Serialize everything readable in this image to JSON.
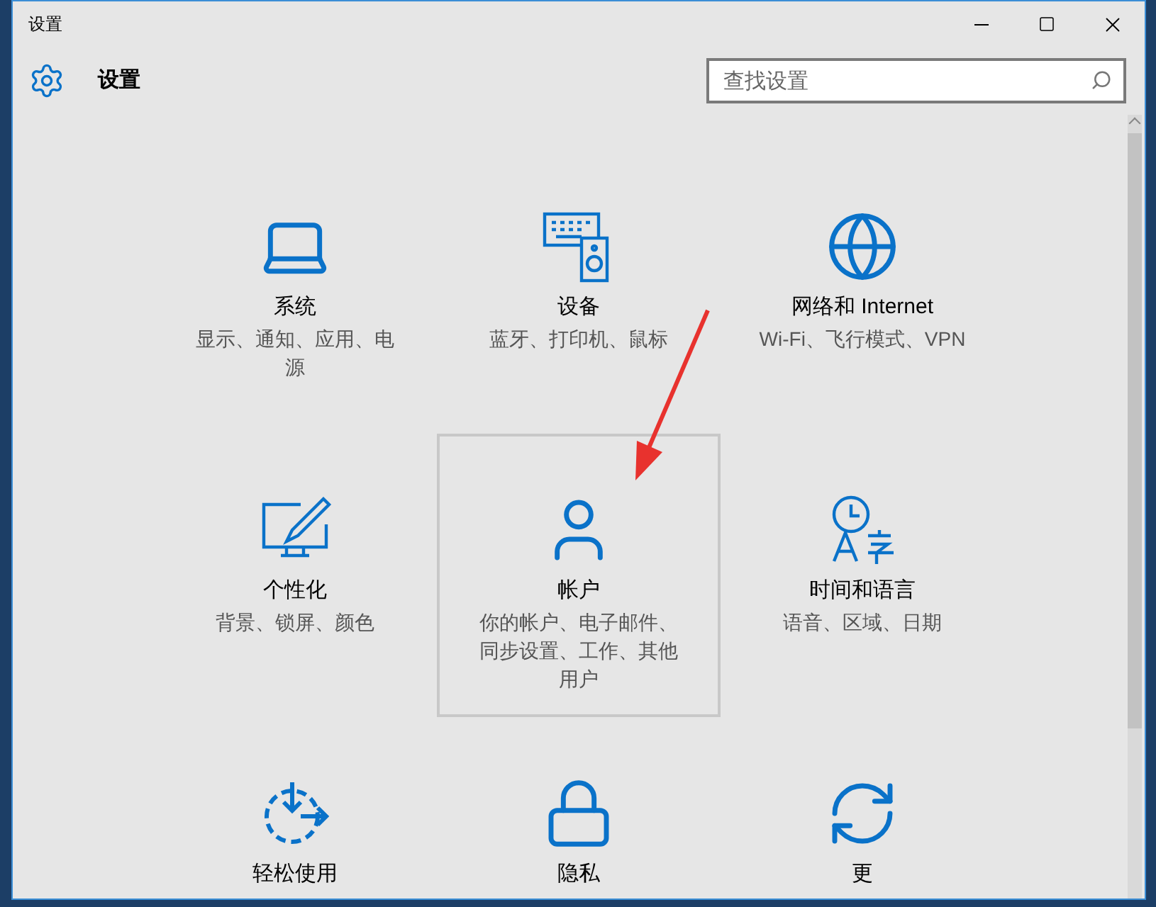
{
  "window": {
    "title": "设置"
  },
  "header": {
    "title": "设置"
  },
  "search": {
    "placeholder": "查找设置"
  },
  "tiles": [
    {
      "kind": "laptop",
      "title": "系统",
      "description": "显示、通知、应用、电源",
      "selected": false
    },
    {
      "kind": "keyboard",
      "title": "设备",
      "description": "蓝牙、打印机、鼠标",
      "selected": false
    },
    {
      "kind": "globe",
      "title": "网络和 Internet",
      "description": "Wi-Fi、飞行模式、VPN",
      "selected": false
    },
    {
      "kind": "paint",
      "title": "个性化",
      "description": "背景、锁屏、颜色",
      "selected": false
    },
    {
      "kind": "user",
      "title": "帐户",
      "description": "你的帐户、电子邮件、同步设置、工作、其他用户",
      "selected": true
    },
    {
      "kind": "clock",
      "title": "时间和语言",
      "description": "语音、区域、日期",
      "selected": false
    },
    {
      "kind": "ease",
      "title": "轻松使用",
      "selected": false
    },
    {
      "kind": "lock",
      "title": "隐私",
      "selected": false
    },
    {
      "kind": "sync",
      "title": "更",
      "selected": false
    }
  ]
}
